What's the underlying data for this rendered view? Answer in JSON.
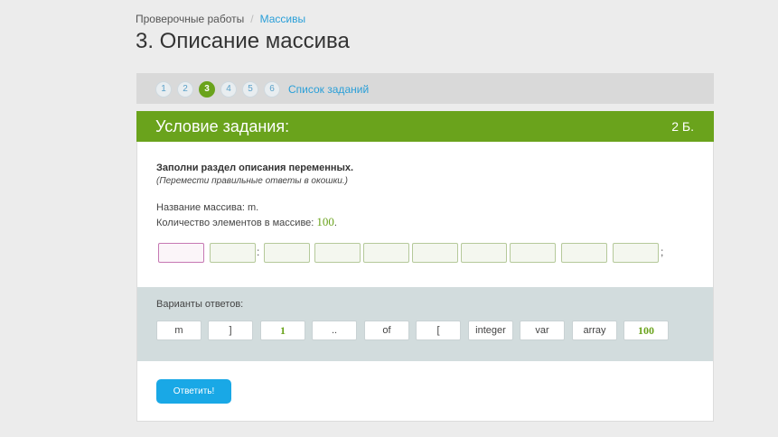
{
  "breadcrumb": {
    "root": "Проверочные работы",
    "separator": "/",
    "current": "Массивы"
  },
  "page_title": "3. Описание массива",
  "task_nav": {
    "numbers": [
      "1",
      "2",
      "3",
      "4",
      "5",
      "6"
    ],
    "active_index": 2,
    "list_link": "Список заданий"
  },
  "card": {
    "header_title": "Условие задания:",
    "points": "2 Б.",
    "instruction": "Заполни раздел описания переменных.",
    "hint": "(Перемести правильные ответы в окошки.)",
    "array_name_line": "Название массива: m.",
    "count_line_prefix": "Количество элементов в массиве: ",
    "count_value": "100",
    "count_suffix": ".",
    "colon": ":",
    "semicolon": ";"
  },
  "answers": {
    "label": "Варианты ответов:",
    "chips": [
      "m",
      "]",
      "1",
      "..",
      "of",
      "[",
      "integer",
      "var",
      "array",
      "100"
    ]
  },
  "submit_label": "Ответить!",
  "colors": {
    "accent_green": "#6aa31c",
    "link_blue": "#2a9fd8",
    "button_blue": "#19a8e6"
  }
}
